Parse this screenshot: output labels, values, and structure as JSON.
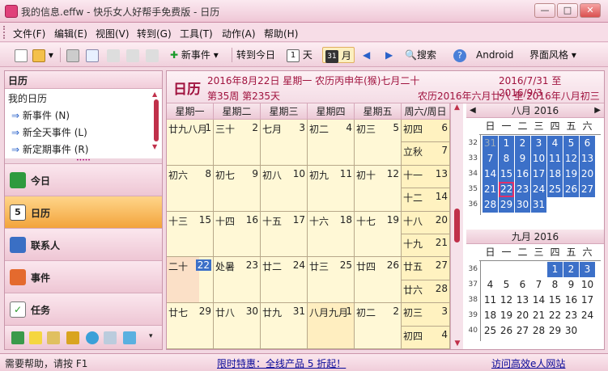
{
  "window": {
    "title": "我的信息.effw - 快乐女人好帮手免费版 - 日历"
  },
  "menu": [
    "文件(F)",
    "编辑(E)",
    "视图(V)",
    "转到(G)",
    "工具(T)",
    "动作(A)",
    "帮助(H)"
  ],
  "toolbar": {
    "new_event": "新事件",
    "goto_today": "转到今日",
    "day": "天",
    "month": "月",
    "search": "搜索",
    "android": "Android",
    "skin": "界面风格",
    "day_num": "1",
    "month_num": "31"
  },
  "left": {
    "header": "日历",
    "list_title": "我的日历",
    "items": [
      "新事件 (N)",
      "新全天事件 (L)",
      "新定期事件 (R)"
    ],
    "nav": [
      "今日",
      "日历",
      "联系人",
      "事件",
      "任务"
    ]
  },
  "cal": {
    "title": "日历",
    "date_line": "2016年8月22日 星期一 农历丙申年(猴)七月二十",
    "range": "2016/7/31 至 2016/9/3",
    "week_line": "第35周 第235天",
    "lunar_range": "农历2016年六月廿八 至 2016年八月初三",
    "headers": [
      "星期一",
      "星期二",
      "星期三",
      "星期四",
      "星期五",
      "周六/周日"
    ],
    "weeks": [
      [
        [
          "廿九八月",
          "1"
        ],
        [
          "三十",
          "2"
        ],
        [
          "七月",
          "3"
        ],
        [
          "初二",
          "4"
        ],
        [
          "初三",
          "5"
        ],
        [
          "初四",
          "6"
        ],
        [
          "立秋",
          "7"
        ]
      ],
      [
        [
          "初六",
          "8"
        ],
        [
          "初七",
          "9"
        ],
        [
          "初八",
          "10"
        ],
        [
          "初九",
          "11"
        ],
        [
          "初十",
          "12"
        ],
        [
          "十一",
          "13"
        ],
        [
          "十二",
          "14"
        ]
      ],
      [
        [
          "十三",
          "15"
        ],
        [
          "十四",
          "16"
        ],
        [
          "十五",
          "17"
        ],
        [
          "十六",
          "18"
        ],
        [
          "十七",
          "19"
        ],
        [
          "十八",
          "20"
        ],
        [
          "十九",
          "21"
        ]
      ],
      [
        [
          "二十",
          "22"
        ],
        [
          "处暑",
          "23"
        ],
        [
          "廿二",
          "24"
        ],
        [
          "廿三",
          "25"
        ],
        [
          "廿四",
          "26"
        ],
        [
          "廿五",
          "27"
        ],
        [
          "廿六",
          "28"
        ]
      ],
      [
        [
          "廿七",
          "29"
        ],
        [
          "廿八",
          "30"
        ],
        [
          "廿九",
          "31"
        ],
        [
          "八月九月",
          "1"
        ],
        [
          "初二",
          "2"
        ],
        [
          "初三",
          "3"
        ],
        [
          "初四",
          "4"
        ]
      ]
    ]
  },
  "mini": {
    "aug_title": "八月 2016",
    "sep_title": "九月 2016",
    "weekdays": [
      "日",
      "一",
      "二",
      "三",
      "四",
      "五",
      "六"
    ],
    "aug_weeks": [
      "32",
      "33",
      "34",
      "35",
      "36"
    ],
    "aug": [
      [
        "31",
        "1",
        "2",
        "3",
        "4",
        "5",
        "6"
      ],
      [
        "7",
        "8",
        "9",
        "10",
        "11",
        "12",
        "13"
      ],
      [
        "14",
        "15",
        "16",
        "17",
        "18",
        "19",
        "20"
      ],
      [
        "21",
        "22",
        "23",
        "24",
        "25",
        "26",
        "27"
      ],
      [
        "28",
        "29",
        "30",
        "31",
        "",
        "",
        ""
      ]
    ],
    "sep_weeks": [
      "36",
      "37",
      "38",
      "39",
      "40"
    ],
    "sep": [
      [
        "",
        "",
        "",
        "",
        "1",
        "2",
        "3"
      ],
      [
        "4",
        "5",
        "6",
        "7",
        "8",
        "9",
        "10"
      ],
      [
        "11",
        "12",
        "13",
        "14",
        "15",
        "16",
        "17"
      ],
      [
        "18",
        "19",
        "20",
        "21",
        "22",
        "23",
        "24"
      ],
      [
        "25",
        "26",
        "27",
        "28",
        "29",
        "30",
        ""
      ]
    ]
  },
  "status": {
    "help": "需要帮助，请按 F1",
    "promo": "限时特惠：全线产品 5 折起！",
    "visit": "访问高效e人网站"
  },
  "colors": {
    "accent": "#3c70c8",
    "brand": "#a0123e",
    "cell": "#fff8d6"
  }
}
